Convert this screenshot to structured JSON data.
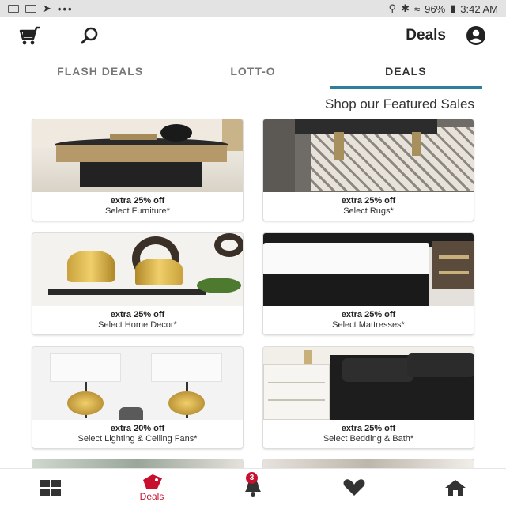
{
  "status_bar": {
    "time": "3:42 AM",
    "battery": "96%",
    "more": "•••"
  },
  "header": {
    "title": "Deals",
    "cart_icon": "cart-icon",
    "search_icon": "search-icon",
    "account_icon": "account-icon"
  },
  "tabs": [
    {
      "label": "DEALS",
      "active": true
    },
    {
      "label": "LOTT-O",
      "active": false
    },
    {
      "label": "FLASH DEALS",
      "active": false
    }
  ],
  "section_title": "Shop our Featured Sales",
  "cards": [
    {
      "deal": "extra 25% off",
      "desc": "Select Rugs*"
    },
    {
      "deal": "extra 25% off",
      "desc": "Select Furniture*"
    },
    {
      "deal": "extra 25% off",
      "desc": "Select Mattresses*"
    },
    {
      "deal": "extra 25% off",
      "desc": "Select Home Decor*"
    },
    {
      "deal": "extra 25% off",
      "desc": "Select Bedding & Bath*"
    },
    {
      "deal": "extra 20% off",
      "desc": "Select Lighting & Ceiling Fans*"
    }
  ],
  "bottom_nav": {
    "home_icon": "home-icon",
    "favorites_icon": "heart-icon",
    "notifications_icon": "bell-icon",
    "notifications_count": "3",
    "deals_label": "Deals",
    "deals_icon": "tag-icon",
    "categories_icon": "grid-icon"
  },
  "colors": {
    "accent": "#c8102e",
    "tab_underline": "#2f7f9a"
  }
}
